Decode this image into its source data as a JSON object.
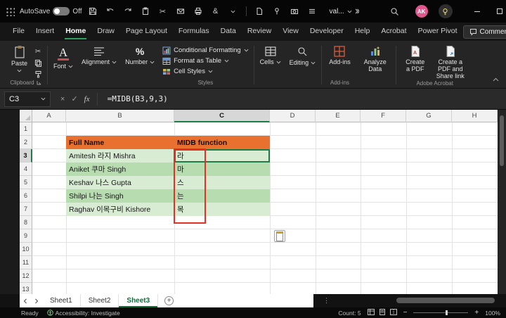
{
  "titlebar": {
    "autosave_label": "AutoSave",
    "autosave_state": "Off",
    "doc_name": "val...",
    "avatar_initials": "AK"
  },
  "ribbon_tabs": [
    "File",
    "Insert",
    "Home",
    "Draw",
    "Page Layout",
    "Formulas",
    "Data",
    "Review",
    "View",
    "Developer",
    "Help",
    "Acrobat",
    "Power Pivot"
  ],
  "active_tab": "Home",
  "ribbon": {
    "comments_label": "Comments",
    "paste_label": "Paste",
    "clipboard_group": "Clipboard",
    "font_label": "Font",
    "alignment_label": "Alignment",
    "number_label": "Number",
    "styles_items": [
      "Conditional Formatting",
      "Format as Table",
      "Cell Styles"
    ],
    "styles_group": "Styles",
    "cells_label": "Cells",
    "editing_label": "Editing",
    "addins_label": "Add-ins",
    "addins_group": "Add-ins",
    "analyze_label": "Analyze Data",
    "acrobat_btn1": "Create a PDF",
    "acrobat_btn2": "Create a PDF and Share link",
    "acrobat_group": "Adobe Acrobat"
  },
  "formula_bar": {
    "name_box": "C3",
    "fx_label": "fx",
    "formula": "=MIDB(B3,9,3)"
  },
  "grid": {
    "columns": [
      "A",
      "B",
      "C",
      "D",
      "E",
      "F",
      "G",
      "H"
    ],
    "row_numbers": [
      "1",
      "2",
      "3",
      "4",
      "5",
      "6",
      "7",
      "8",
      "9",
      "10",
      "11",
      "12",
      "13"
    ],
    "selected_cell": "C3",
    "table": {
      "header_name": "Full Name",
      "header_func": "MIDB function",
      "rows": [
        {
          "name": "Amitesh 라지 Mishra",
          "result": "라"
        },
        {
          "name": "Aniket 쿠마  Singh",
          "result": "마"
        },
        {
          "name": "Keshav 나스 Gupta",
          "result": "스"
        },
        {
          "name": "Shilpi 나는  Singh",
          "result": "는"
        },
        {
          "name": "Raghav 이목구비 Kishore",
          "result": "목"
        }
      ]
    }
  },
  "sheet_tabs": [
    "Sheet1",
    "Sheet2",
    "Sheet3"
  ],
  "active_sheet": "Sheet3",
  "status_bar": {
    "mode": "Ready",
    "accessibility": "Accessibility: Investigate",
    "count": "Count: 5",
    "zoom": "100%"
  },
  "colors": {
    "header_fill": "#E8712F",
    "band_light": "#D8EBD3",
    "band_dark": "#B7DCB0",
    "accent_green": "#1E7D45",
    "annotation_red": "#E03325",
    "avatar_pink": "#E3568C"
  }
}
